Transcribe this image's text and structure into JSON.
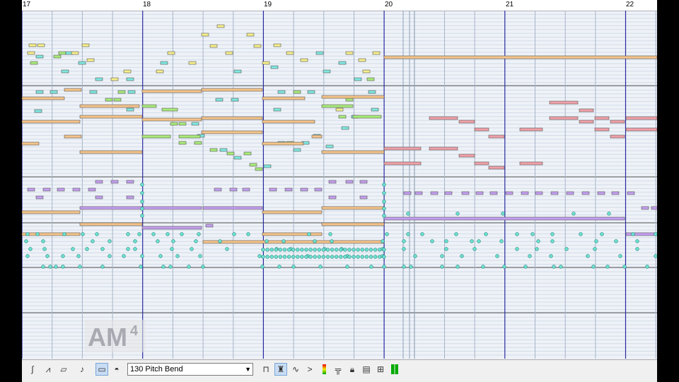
{
  "ruler": {
    "measures": [
      "17",
      "18",
      "19",
      "20",
      "21",
      "22"
    ]
  },
  "toolbar": {
    "controller_value": "130 Pitch Bend",
    "icons": [
      "curve-icon",
      "pencil-icon",
      "eraser-icon",
      "note-icon",
      "select-rect-icon",
      "bucket-icon",
      "bars-icon",
      "stamp-icon",
      "wave-icon",
      "greater-icon",
      "meter-icon",
      "bench-icon",
      "lock-icon",
      "window-icon",
      "graph-icon",
      "level-icon"
    ]
  },
  "logo": {
    "text": "AM",
    "superscript": "4"
  },
  "colors": {
    "yellow": "#f6ee8a",
    "cyan": "#7fe8e0",
    "green": "#a8ea7a",
    "orange": "#f4c48a",
    "pink": "#f0a0a8",
    "purple": "#c49ef0",
    "teal_dot": "#6de0d0",
    "measure_line": "#2a2aa0",
    "beat_line": "#a8b4c8"
  }
}
